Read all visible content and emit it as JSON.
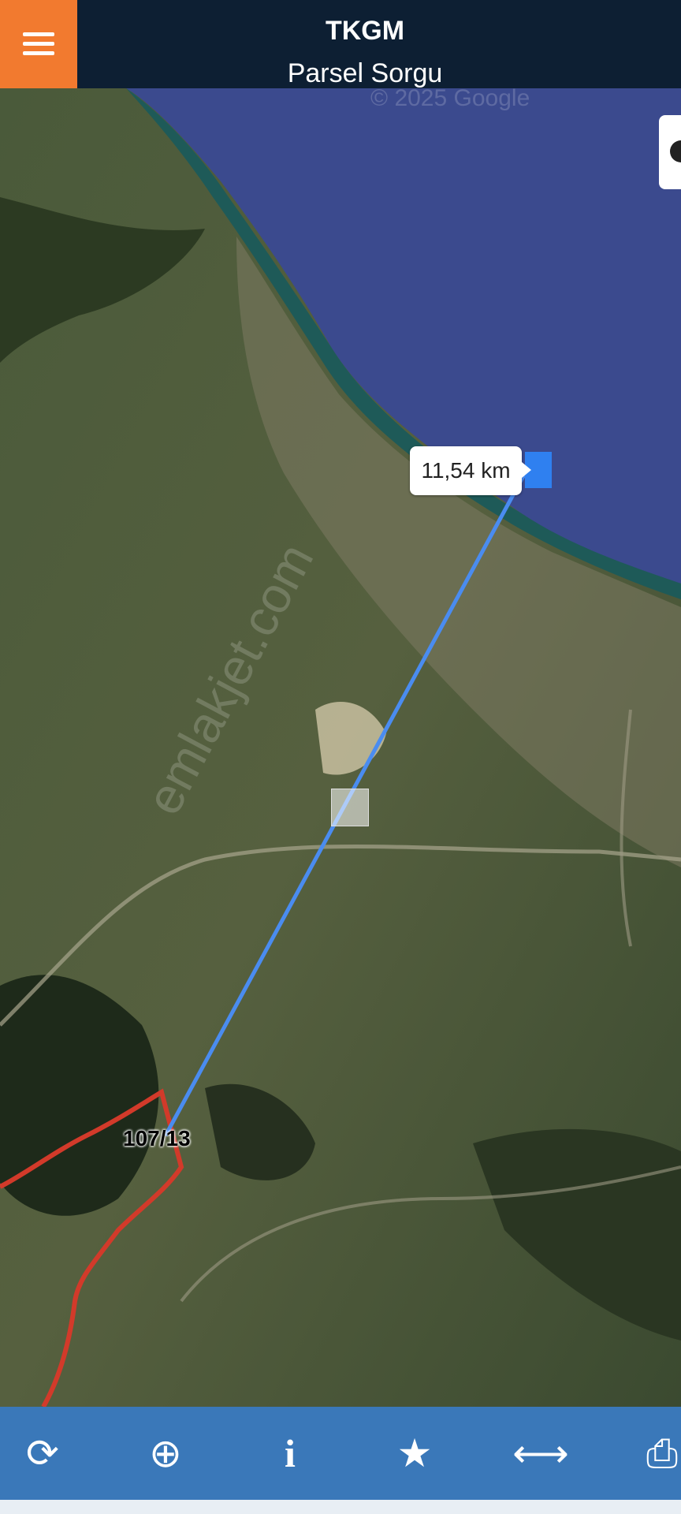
{
  "header": {
    "title": "TKGM",
    "subtitle": "Parsel Sorgu",
    "menu_icon": "menu-icon"
  },
  "map": {
    "copyright": "© 2025 Google",
    "watermark": "emlakjet.com",
    "distance_label": "11,54 km",
    "parcel_label": "107/13",
    "colors": {
      "measure_line": "#4a8cf0",
      "parcel_border": "#d23a2a",
      "sea": "#3b4a8e",
      "header": "#0d1f33",
      "menu": "#f27a2f",
      "toolbar": "#3a78b9"
    }
  },
  "toolbar": {
    "items": [
      {
        "icon": "refresh-icon",
        "glyph": "⟳"
      },
      {
        "icon": "locate-icon",
        "glyph": "⊕"
      },
      {
        "icon": "info-icon",
        "glyph": "i"
      },
      {
        "icon": "star-icon",
        "glyph": "★"
      },
      {
        "icon": "measure-icon",
        "glyph": "⟷"
      },
      {
        "icon": "print-icon",
        "glyph": "⎙"
      }
    ]
  }
}
